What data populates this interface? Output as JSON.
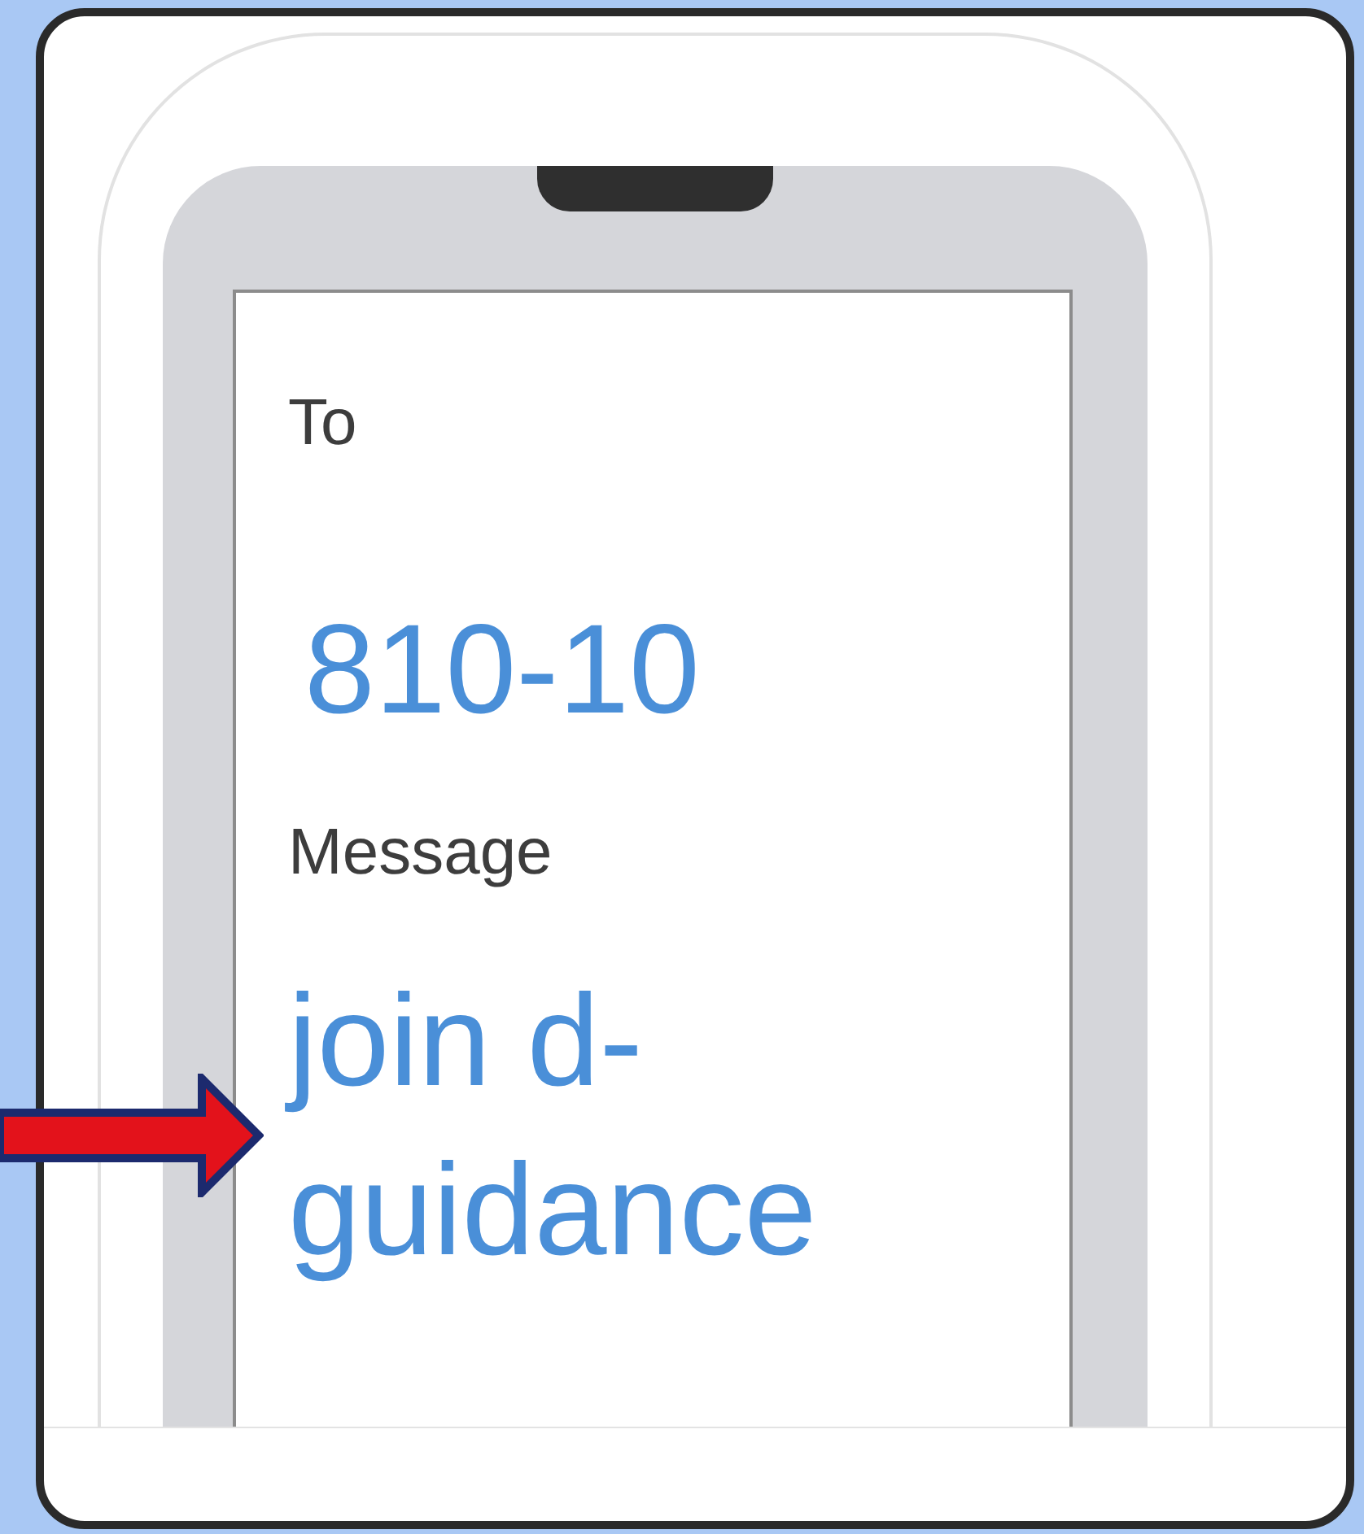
{
  "to_label": "To",
  "recipient": "810-10",
  "message_label": "Message",
  "message": "join d-guidance"
}
